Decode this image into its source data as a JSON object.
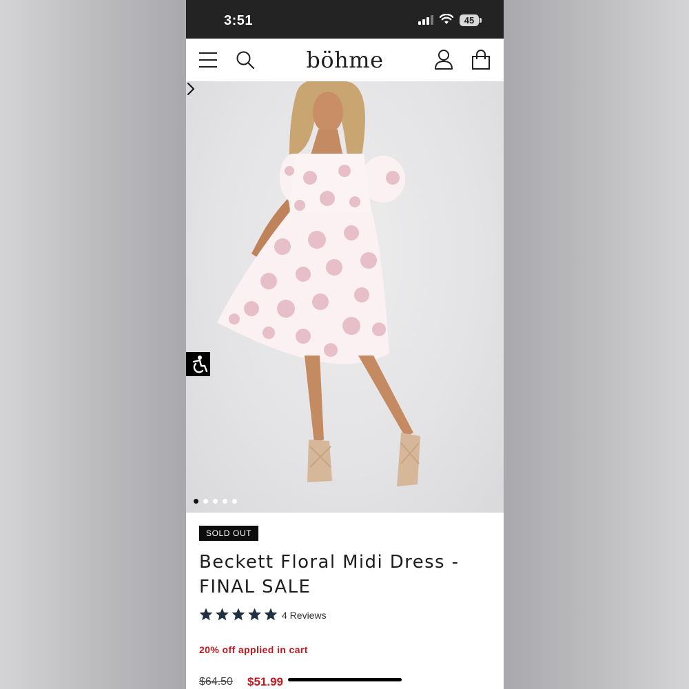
{
  "status_bar": {
    "time": "3:51",
    "battery": "45",
    "icons": [
      "signal-icon",
      "wifi-icon",
      "battery-icon"
    ]
  },
  "header": {
    "brand": "böhme",
    "icons": [
      "menu-icon",
      "search-icon",
      "account-icon",
      "cart-icon"
    ]
  },
  "gallery": {
    "image_count": 5,
    "active_index": 0,
    "icons": [
      "chevron-right-icon",
      "accessibility-icon"
    ]
  },
  "product": {
    "badge": "SOLD OUT",
    "title_line1": "Beckett Floral Midi Dress -",
    "title_line2": "FINAL SALE",
    "rating": 5,
    "review_count": "4 Reviews",
    "promo": "20% off applied in cart",
    "original_price": "$64.50",
    "sale_price": "$51.99"
  },
  "colors": {
    "accent_red": "#c4161c",
    "star": "#1f3140",
    "status_bar": "#232323"
  }
}
